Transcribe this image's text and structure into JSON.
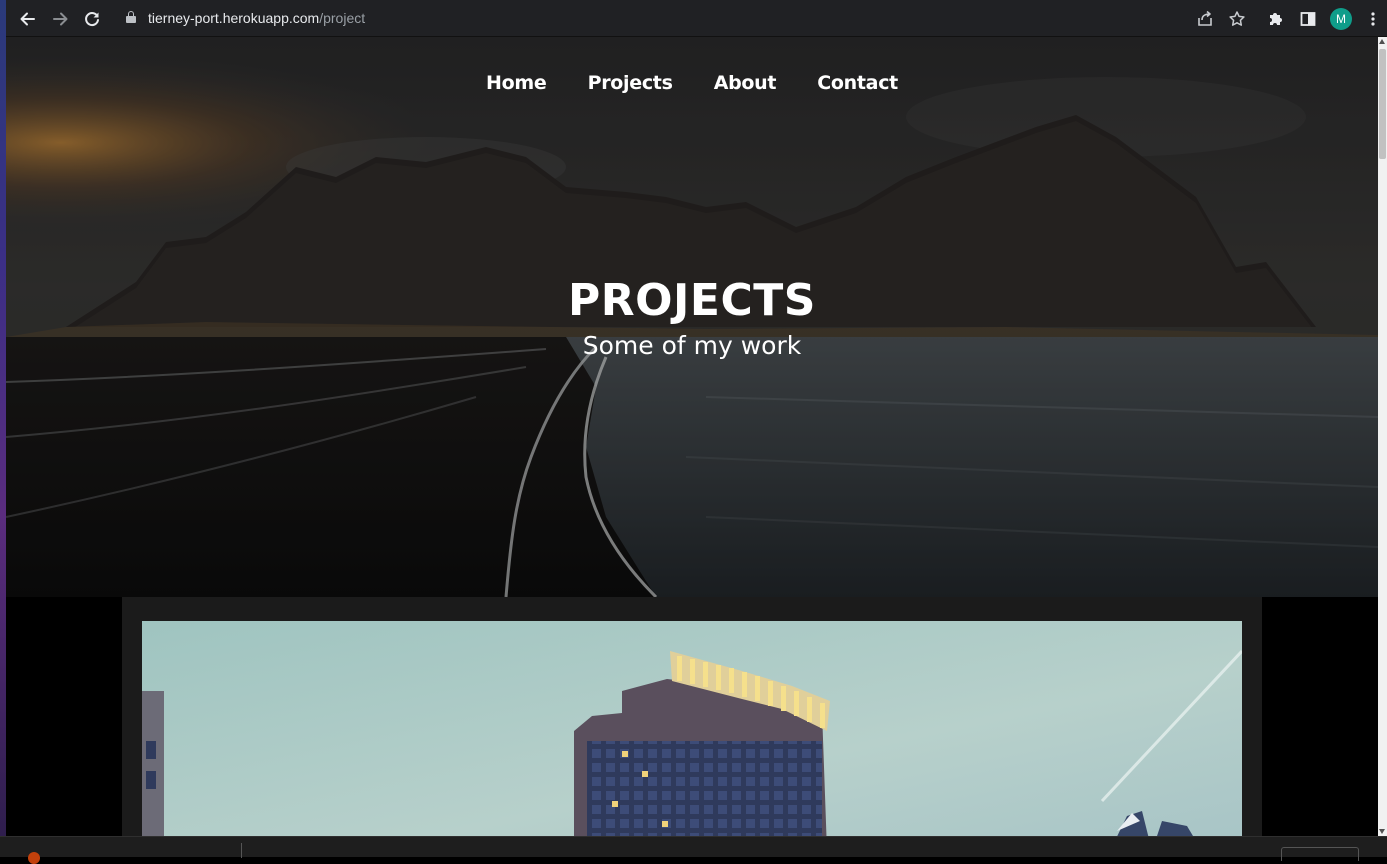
{
  "browser": {
    "url_host": "tierney-port.herokuapp.com",
    "url_path": "/project",
    "profile_initial": "M",
    "icons": {
      "back": "arrow-left-icon",
      "forward": "arrow-right-icon",
      "reload": "reload-icon",
      "lock": "lock-icon",
      "share": "share-icon",
      "bookmark": "star-icon",
      "extensions": "puzzle-icon",
      "side_panel": "side-panel-icon",
      "menu": "kebab-menu-icon"
    },
    "colors": {
      "chrome_bg": "#202124",
      "avatar_bg": "#0f9d8a"
    }
  },
  "site_nav": {
    "items": [
      {
        "label": "Home"
      },
      {
        "label": "Projects"
      },
      {
        "label": "About"
      },
      {
        "label": "Contact"
      }
    ]
  },
  "hero": {
    "title": "PROJECTS",
    "subtitle": "Some of my work"
  },
  "colors": {
    "page_bg": "#000000",
    "card_bg": "#1b1b1b",
    "text": "#ffffff"
  }
}
